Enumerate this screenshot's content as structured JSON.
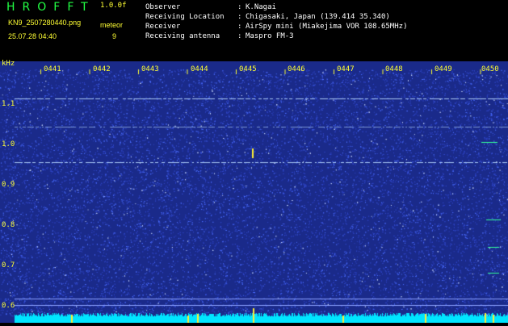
{
  "header": {
    "app_title": "HROFFT",
    "version": "1.0.0f",
    "filename": "KN9_2507280440.png",
    "timestamp": "25.07.28 04:40",
    "meteor_label": "meteor",
    "meteor_count": "9",
    "info": [
      {
        "key": "Observer",
        "colon": ":",
        "value": "K.Nagai"
      },
      {
        "key": "Receiving Location",
        "colon": ":",
        "value": "Chigasaki, Japan (139.414 35.340)"
      },
      {
        "key": "Receiver",
        "colon": ":",
        "value": "AirSpy mini (Miakejima VOR 108.65MHz)"
      },
      {
        "key": "Receiving antenna",
        "colon": ":",
        "value": "Maspro FM-3"
      }
    ]
  },
  "spectrogram": {
    "y_unit": "kHz",
    "y_ticks": [
      "1.1",
      "1.0",
      "0.9",
      "0.8",
      "0.7",
      "0.6"
    ],
    "time_ticks": [
      "0441",
      "0442",
      "0443",
      "0444",
      "0445",
      "0446",
      "0447",
      "0448",
      "0449",
      "0450"
    ],
    "colors": {
      "background": "#1a2a8a",
      "noise": "#4a6cff",
      "carrier": "#b8d8ff",
      "baseline": "#00e5ff",
      "label": "#ffff33"
    }
  }
}
